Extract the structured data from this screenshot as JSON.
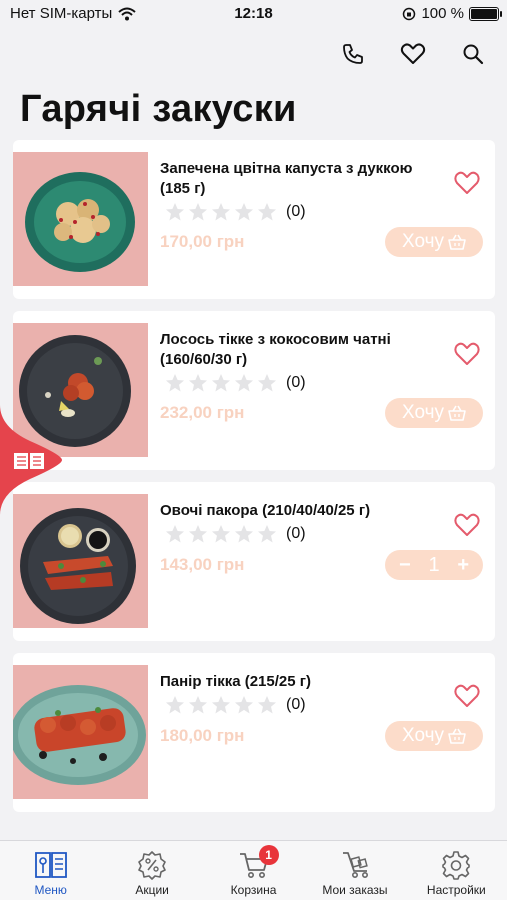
{
  "status_bar": {
    "carrier": "Нет SIM-карты",
    "time": "12:18",
    "battery": "100 %"
  },
  "header": {
    "icons": [
      "phone-icon",
      "heart-icon",
      "search-icon"
    ]
  },
  "page": {
    "title": "Гарячі закуски"
  },
  "products": [
    {
      "name": "Запечена цвітна капуста з дуккою (185 г)",
      "rating_count": "(0)",
      "price": "170,00 грн",
      "action": "want",
      "action_label": "Хочу"
    },
    {
      "name": "Лосось тікке з кокосовим чатні (160/60/30 г)",
      "rating_count": "(0)",
      "price": "232,00 грн",
      "action": "want",
      "action_label": "Хочу"
    },
    {
      "name": "Овочі пакора (210/40/40/25 г)",
      "rating_count": "(0)",
      "price": "143,00 грн",
      "action": "stepper",
      "quantity": "1",
      "minus": "−",
      "plus": "+"
    },
    {
      "name": "Панір тікка (215/25 г)",
      "rating_count": "(0)",
      "price": "180,00 грн",
      "action": "want",
      "action_label": "Хочу"
    }
  ],
  "tabbar": {
    "items": [
      {
        "label": "Меню",
        "icon": "menu-book-icon",
        "active": true
      },
      {
        "label": "Акции",
        "icon": "discount-icon"
      },
      {
        "label": "Корзина",
        "icon": "cart-icon",
        "badge": "1"
      },
      {
        "label": "Мои заказы",
        "icon": "orders-cart-icon"
      },
      {
        "label": "Настройки",
        "icon": "gear-icon"
      }
    ]
  },
  "colors": {
    "accent": "#e8343b",
    "price": "#f8d2c0",
    "button": "#fcdcca",
    "heart": "#e45b6c",
    "active_tab": "#1f57c3"
  }
}
